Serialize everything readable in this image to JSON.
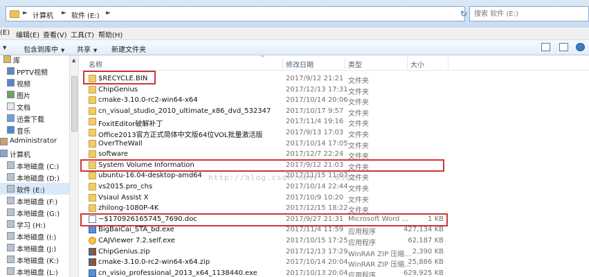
{
  "address": {
    "back_arrow": "◄",
    "forward_arrow": "►",
    "crumbs": [
      "计算机",
      "软件 (E:)"
    ],
    "separator": "►",
    "search_placeholder": "搜索 软件 (E:)"
  },
  "menu": {
    "items": [
      "(E)",
      "编辑(E)",
      "查看(V)",
      "工具(T)",
      "帮助(H)"
    ]
  },
  "toolbar": {
    "include_label": "包含到库中",
    "share_label": "共享",
    "new_folder_label": "新建文件夹",
    "caret": "▼"
  },
  "nav": {
    "items": [
      {
        "label": "库",
        "icon": "library-icon"
      },
      {
        "label": "PPTV视频",
        "icon": "video-icon"
      },
      {
        "label": "视频",
        "icon": "video-icon"
      },
      {
        "label": "图片",
        "icon": "pictures-icon"
      },
      {
        "label": "文档",
        "icon": "documents-icon"
      },
      {
        "label": "迅雷下载",
        "icon": "download-icon"
      },
      {
        "label": "音乐",
        "icon": "music-icon"
      },
      {
        "label": "Administrator",
        "icon": "user-icon"
      },
      {
        "label": "计算机",
        "icon": "computer-icon"
      },
      {
        "label": "本地磁盘 (C:)",
        "icon": "drive-icon"
      },
      {
        "label": "本地磁盘 (D:)",
        "icon": "drive-icon"
      },
      {
        "label": "软件 (E:)",
        "icon": "drive-icon",
        "selected": true
      },
      {
        "label": "本地磁盘 (F:)",
        "icon": "drive-icon"
      },
      {
        "label": "本地磁盘 (G:)",
        "icon": "drive-icon"
      },
      {
        "label": "学习 (H:)",
        "icon": "drive-icon"
      },
      {
        "label": "本地磁盘 (I:)",
        "icon": "drive-icon"
      },
      {
        "label": "本地磁盘 (J:)",
        "icon": "drive-icon"
      },
      {
        "label": "本地磁盘 (K:)",
        "icon": "drive-icon"
      },
      {
        "label": "本地磁盘 (L:)",
        "icon": "drive-icon"
      }
    ]
  },
  "columns": {
    "name": "名称",
    "date": "修改日期",
    "type": "类型",
    "size": "大小",
    "sort_indicator": "^"
  },
  "files": [
    {
      "name": "$RECYCLE.BIN",
      "date": "2017/9/12 21:21",
      "type": "文件夹",
      "size": "",
      "icon": "folder-icon"
    },
    {
      "name": "ChipGenius",
      "date": "2017/12/13 17:31",
      "type": "文件夹",
      "size": "",
      "icon": "folder-icon"
    },
    {
      "name": "cmake-3.10.0-rc2-win64-x64",
      "date": "2017/10/14 20:06",
      "type": "文件夹",
      "size": "",
      "icon": "folder-icon"
    },
    {
      "name": "cn_visual_studio_2010_ultimate_x86_dvd_532347",
      "date": "2017/10/17 9:57",
      "type": "文件夹",
      "size": "",
      "icon": "folder-icon"
    },
    {
      "name": "FoxitEditor破解补丁",
      "date": "2017/11/4 19:16",
      "type": "文件夹",
      "size": "",
      "icon": "folder-icon"
    },
    {
      "name": "Office2013官方正式简体中文版64位VOL批量激活版",
      "date": "2017/9/13 17:03",
      "type": "文件夹",
      "size": "",
      "icon": "folder-icon"
    },
    {
      "name": "OverTheWall",
      "date": "2017/10/14 17:05",
      "type": "文件夹",
      "size": "",
      "icon": "folder-icon"
    },
    {
      "name": "software",
      "date": "2017/12/7 22:24",
      "type": "文件夹",
      "size": "",
      "icon": "folder-icon"
    },
    {
      "name": "System Volume Information",
      "date": "2017/9/12 21:03",
      "type": "文件夹",
      "size": "",
      "icon": "lock-folder-icon"
    },
    {
      "name": "ubuntu-16.04-desktop-amd64",
      "date": "2017/11/15 11:07",
      "type": "文件夹",
      "size": "",
      "icon": "folder-icon"
    },
    {
      "name": "vs2015.pro_chs",
      "date": "2017/10/14 22:44",
      "type": "文件夹",
      "size": "",
      "icon": "folder-icon"
    },
    {
      "name": "Vsiaul Assist X",
      "date": "2017/10/9 10:20",
      "type": "文件夹",
      "size": "",
      "icon": "folder-icon"
    },
    {
      "name": "zhilong-1080P-4K",
      "date": "2017/12/15 18:22",
      "type": "文件夹",
      "size": "",
      "icon": "folder-icon"
    },
    {
      "name": "~$170926165745_7690.doc",
      "date": "2017/9/27 21:31",
      "type": "Microsoft Word ...",
      "size": "1 KB",
      "icon": "document-icon"
    },
    {
      "name": "BigBaiCai_STA_bd.exe",
      "date": "2017/11/4 11:59",
      "type": "应用程序",
      "size": "427,134 KB",
      "icon": "app-icon"
    },
    {
      "name": "CAJViewer 7.2.self.exe",
      "date": "2017/10/15 17:25",
      "type": "应用程序",
      "size": "62,187 KB",
      "icon": "app-icon"
    },
    {
      "name": "ChipGenius.zip",
      "date": "2017/12/13 17:29",
      "type": "WinRAR ZIP 压缩...",
      "size": "2,390 KB",
      "icon": "zip-icon"
    },
    {
      "name": "cmake-3.10.0-rc2-win64-x64.zip",
      "date": "2017/10/14 20:04",
      "type": "WinRAR ZIP 压缩...",
      "size": "25,886 KB",
      "icon": "zip-icon"
    },
    {
      "name": "cn_visio_professional_2013_x64_1138440.exe",
      "date": "2017/10/13 20:04",
      "type": "应用程序",
      "size": "629,925 KB",
      "icon": "app-icon"
    }
  ],
  "watermark": "http://blog.csdn.net/...8563",
  "colors": {
    "highlight": "#d2323a",
    "selected_nav": "#d9e9f9"
  }
}
